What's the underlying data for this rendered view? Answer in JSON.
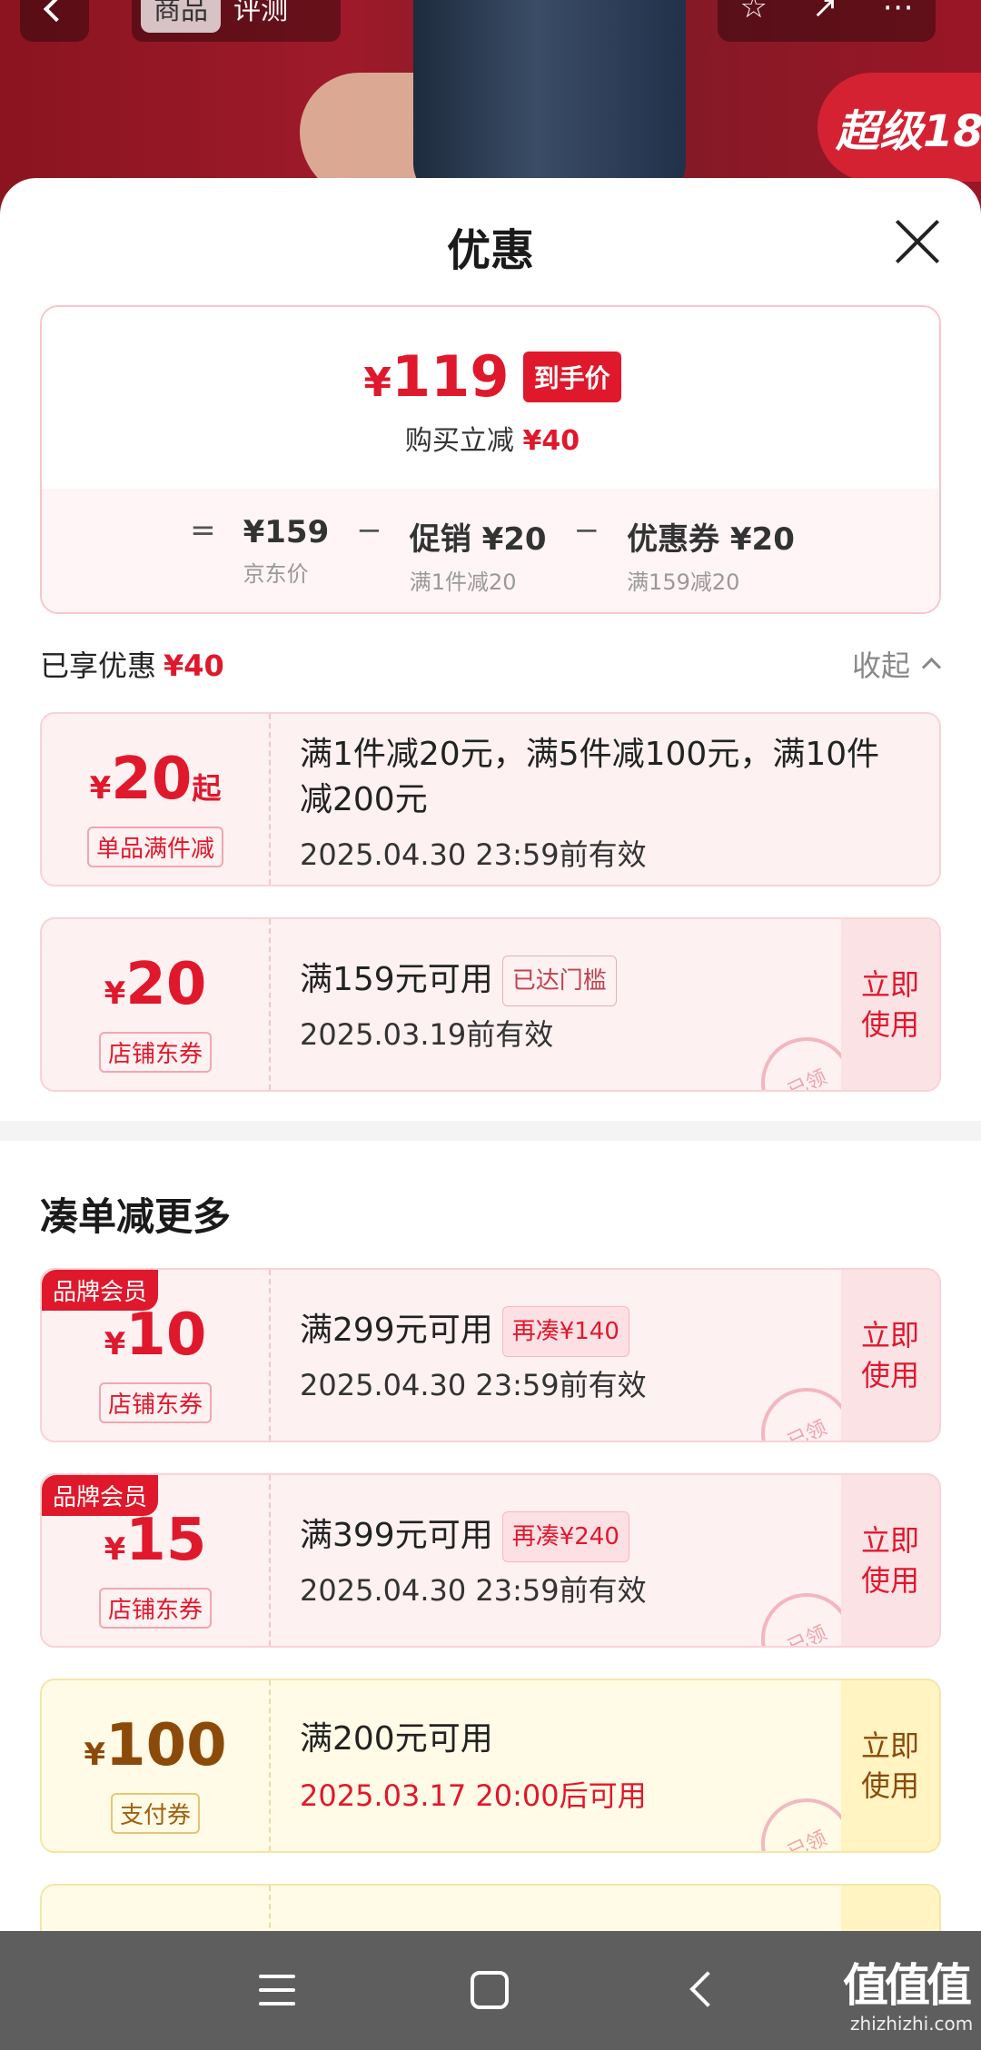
{
  "topbar": {
    "tabs": [
      "商品",
      "评测"
    ],
    "badge": "超级18"
  },
  "sheet": {
    "title": "优惠"
  },
  "price_summary": {
    "currency": "¥",
    "final_price": "119",
    "final_label": "到手价",
    "instant_discount_label": "购买立减",
    "instant_discount": "¥40",
    "formula": [
      {
        "value": "¥159",
        "note": "京东价"
      },
      {
        "value": "促销 ¥20",
        "note": "满1件减20"
      },
      {
        "value": "优惠券 ¥20",
        "note": "满159减20"
      }
    ]
  },
  "enjoyed": {
    "label": "已享优惠",
    "amount": "¥40",
    "collapse_label": "收起"
  },
  "coupons": [
    {
      "amount": "20",
      "suffix": "起",
      "type": "单品满件减",
      "title": "满1件减20元，满5件减100元，满10件减200元",
      "date": "2025.04.30 23:59前有效"
    },
    {
      "amount": "20",
      "type": "店铺东券",
      "title": "满159元可用",
      "chip": "已达门槛",
      "date": "2025.03.19前有效",
      "button": "立即使用",
      "stamp": "已领"
    }
  ],
  "more_section": {
    "title": "凑单减更多"
  },
  "more_coupons": [
    {
      "member_tag": "品牌会员",
      "amount": "10",
      "type": "店铺东券",
      "title": "满299元可用",
      "chip": "再凑¥140",
      "date": "2025.04.30 23:59前有效",
      "button": "立即使用",
      "stamp": "已领"
    },
    {
      "member_tag": "品牌会员",
      "amount": "15",
      "type": "店铺东券",
      "title": "满399元可用",
      "chip": "再凑¥240",
      "date": "2025.04.30 23:59前有效",
      "button": "立即使用",
      "stamp": "已领"
    },
    {
      "amount": "100",
      "type": "支付券",
      "title": "满200元可用",
      "date": "2025.03.17 20:00后可用",
      "button": "立即使用",
      "stamp": "已领"
    }
  ],
  "watermark": {
    "brand": "值值值",
    "domain": "zhizhizhi.com"
  },
  "colors": {
    "accent": "#e0182c",
    "coupon_pink": "#fdf1f2",
    "coupon_yellow": "#fffbe6"
  }
}
